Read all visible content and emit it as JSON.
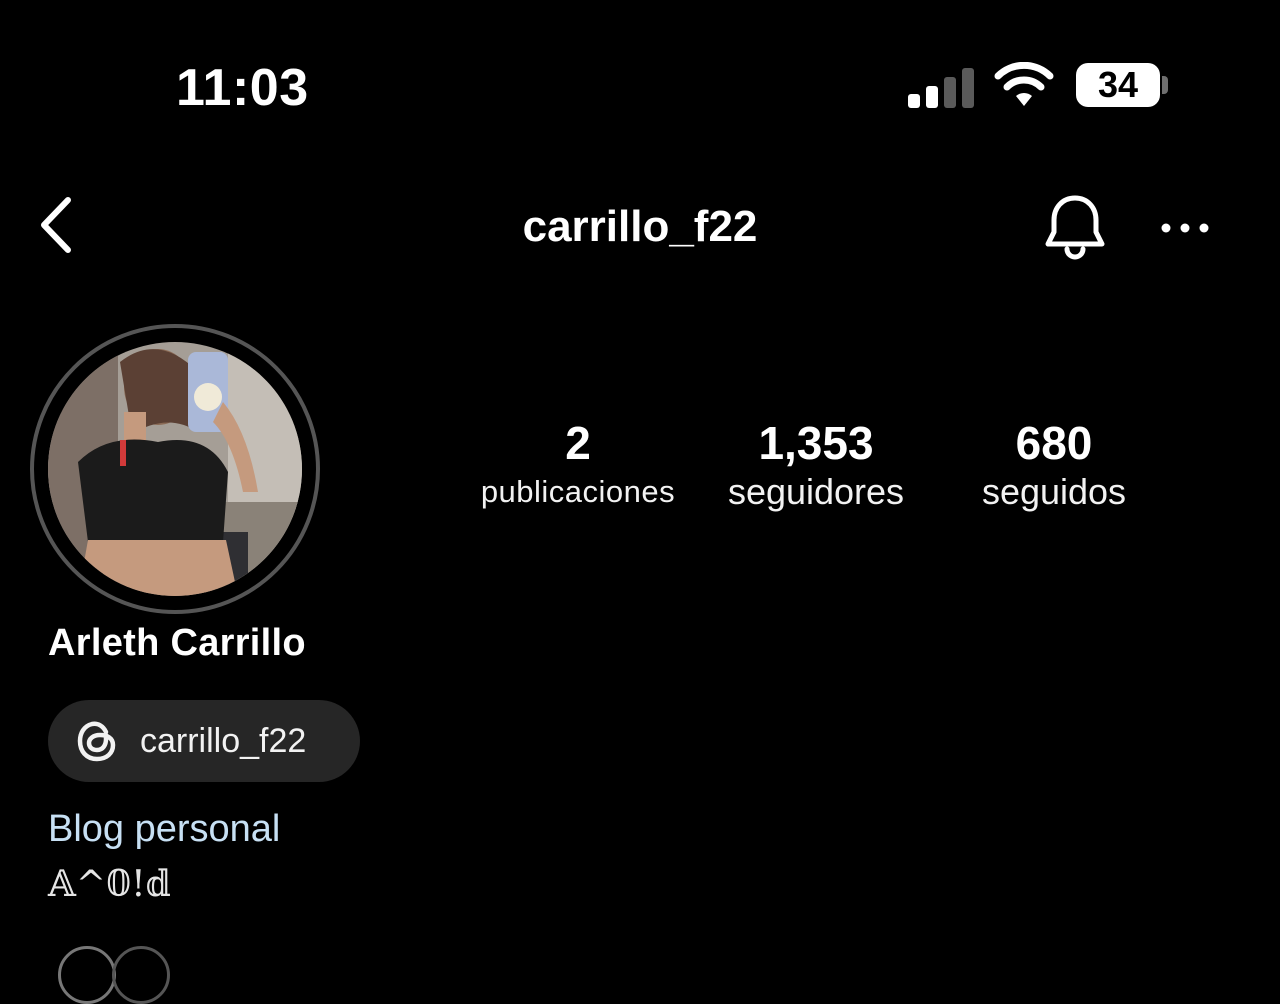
{
  "status_bar": {
    "time": "11:03",
    "battery": "34"
  },
  "header": {
    "username": "carrillo_f22",
    "back_icon": "chevron-left-icon",
    "bell_icon": "bell-icon",
    "more_icon": "more-dots-icon"
  },
  "stats": [
    {
      "value": "2",
      "label": "publicaciones"
    },
    {
      "value": "1,353",
      "label": "seguidores"
    },
    {
      "value": "680",
      "label": "seguidos"
    }
  ],
  "profile": {
    "display_name": "Arleth Carrillo",
    "threads_handle": "carrillo_f22",
    "category": "Blog personal",
    "bio": "𝔸^𝟘!𝕕"
  },
  "colors": {
    "background": "#000000",
    "pill": "#262626",
    "category_text": "#c7e0f4"
  }
}
